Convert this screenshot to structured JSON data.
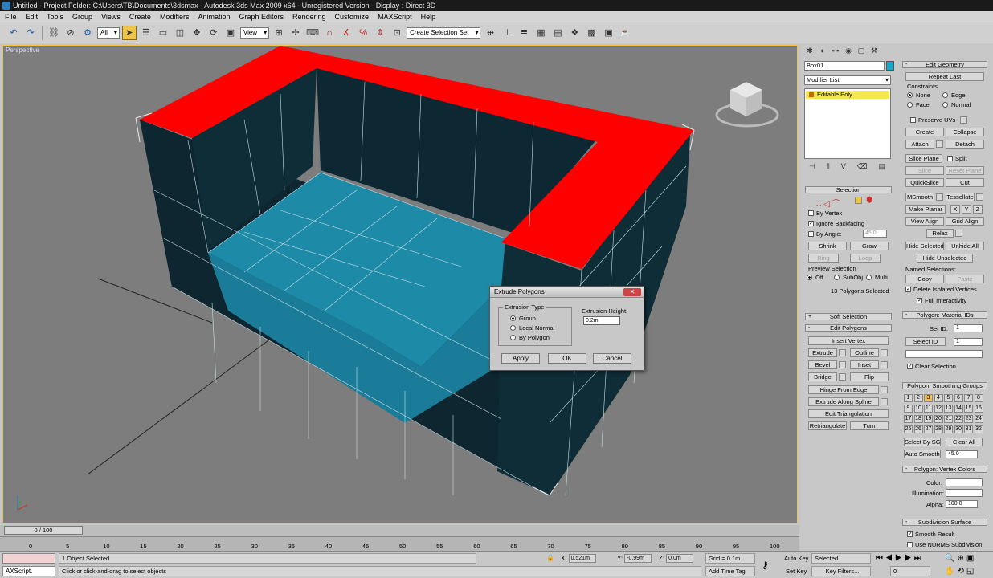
{
  "window": {
    "title": "Untitled   - Project Folder: C:\\Users\\TB\\Documents\\3dsmax     - Autodesk 3ds Max  2009 x64    - Unregistered Version     - Display : Direct 3D"
  },
  "menu": [
    "File",
    "Edit",
    "Tools",
    "Group",
    "Views",
    "Create",
    "Modifiers",
    "Animation",
    "Graph Editors",
    "Rendering",
    "Customize",
    "MAXScript",
    "Help"
  ],
  "toolbar": {
    "filter": "All",
    "ref_coord": "View",
    "named_sel": "Create Selection Set"
  },
  "viewport": {
    "label": "Perspective",
    "highlight_color": "#f0c34a",
    "poly_color": "#1a8aa8",
    "top_color": "#ff0000",
    "dark_color": "#0e2a33"
  },
  "dialog": {
    "title": "Extrude Polygons",
    "group_label": "Extrusion Type",
    "options": [
      "Group",
      "Local Normal",
      "By Polygon"
    ],
    "height_label": "Extrusion Height:",
    "height_value": "0.2m",
    "apply": "Apply",
    "ok": "OK",
    "cancel": "Cancel"
  },
  "command_panel": {
    "object_name": "Box01",
    "modifier_list": "Modifier List",
    "stack_item": "Editable Poly",
    "selection": {
      "title": "Selection",
      "by_vertex": "By Vertex",
      "ignore_backfacing": "Ignore Backfacing",
      "by_angle": "By Angle:",
      "angle_value": "45.0",
      "shrink": "Shrink",
      "grow": "Grow",
      "ring": "Ring",
      "loop": "Loop",
      "preview": "Preview Selection",
      "off": "Off",
      "subobj": "SubObj",
      "multi": "Multi",
      "status": "13 Polygons Selected"
    },
    "soft_selection": "Soft Selection",
    "edit_polygons": {
      "title": "Edit Polygons",
      "insert_vertex": "Insert Vertex",
      "extrude": "Extrude",
      "outline": "Outline",
      "bevel": "Bevel",
      "inset": "Inset",
      "bridge": "Bridge",
      "flip": "Flip",
      "hinge": "Hinge From Edge",
      "extrude_spline": "Extrude Along Spline",
      "edit_tri": "Edit Triangulation",
      "retriangulate": "Retriangulate",
      "turn": "Turn"
    },
    "edit_geometry": {
      "title": "Edit Geometry",
      "repeat_last": "Repeat Last",
      "constraints": "Constraints",
      "none": "None",
      "edge": "Edge",
      "face": "Face",
      "normal": "Normal",
      "preserve_uvs": "Preserve UVs",
      "create": "Create",
      "collapse": "Collapse",
      "attach": "Attach",
      "detach": "Detach",
      "slice_plane": "Slice Plane",
      "split": "Split",
      "slice": "Slice",
      "reset_plane": "Reset Plane",
      "quickslice": "QuickSlice",
      "cut": "Cut",
      "msmooth": "MSmooth",
      "tessellate": "Tessellate",
      "make_planar": "Make Planar",
      "x": "X",
      "y": "Y",
      "z": "Z",
      "view_align": "View Align",
      "grid_align": "Grid Align",
      "relax": "Relax",
      "hide_selected": "Hide Selected",
      "unhide_all": "Unhide All",
      "hide_unselected": "Hide Unselected",
      "named_selections": "Named Selections:",
      "copy": "Copy",
      "paste": "Paste",
      "delete_isolated": "Delete Isolated Vertices",
      "full_interactivity": "Full Interactivity"
    },
    "material_ids": {
      "title": "Polygon: Material IDs",
      "set_id": "Set ID:",
      "select_id": "Select ID",
      "id_value": "1",
      "clear_selection": "Clear Selection"
    },
    "smoothing": {
      "title": "Polygon: Smoothing Groups",
      "groups": [
        "1",
        "2",
        "3",
        "4",
        "5",
        "6",
        "7",
        "8",
        "9",
        "10",
        "11",
        "12",
        "13",
        "14",
        "15",
        "16",
        "17",
        "18",
        "19",
        "20",
        "21",
        "22",
        "23",
        "24",
        "25",
        "26",
        "27",
        "28",
        "29",
        "30",
        "31",
        "32"
      ],
      "select_by_sg": "Select By SG",
      "clear_all": "Clear All",
      "auto_smooth": "Auto Smooth",
      "auto_value": "45.0"
    },
    "vertex_colors": {
      "title": "Polygon: Vertex Colors",
      "color": "Color:",
      "illumination": "Illumination:",
      "alpha": "Alpha:",
      "alpha_value": "100.0"
    },
    "subdivision": {
      "title": "Subdivision Surface",
      "smooth_result": "Smooth Result",
      "use_nurms": "Use NURMS Subdivision"
    }
  },
  "timeline": {
    "frame": "0 / 100",
    "ticks": [
      "0",
      "5",
      "10",
      "15",
      "20",
      "25",
      "30",
      "35",
      "40",
      "45",
      "50",
      "55",
      "60",
      "65",
      "70",
      "75",
      "80",
      "85",
      "90",
      "95",
      "100"
    ]
  },
  "status": {
    "maxscript": "AXScript.",
    "selected": "1 Object Selected",
    "prompt": "Click or click-and-drag to select objects",
    "x": "0.521m",
    "y": "-0.99m",
    "z": "0.0m",
    "grid": "Grid = 0.1m",
    "auto_key": "Auto Key",
    "set_key": "Set Key",
    "selected_mode": "Selected",
    "key_filters": "Key Filters...",
    "add_time_tag": "Add Time Tag",
    "frame_field": "0"
  }
}
